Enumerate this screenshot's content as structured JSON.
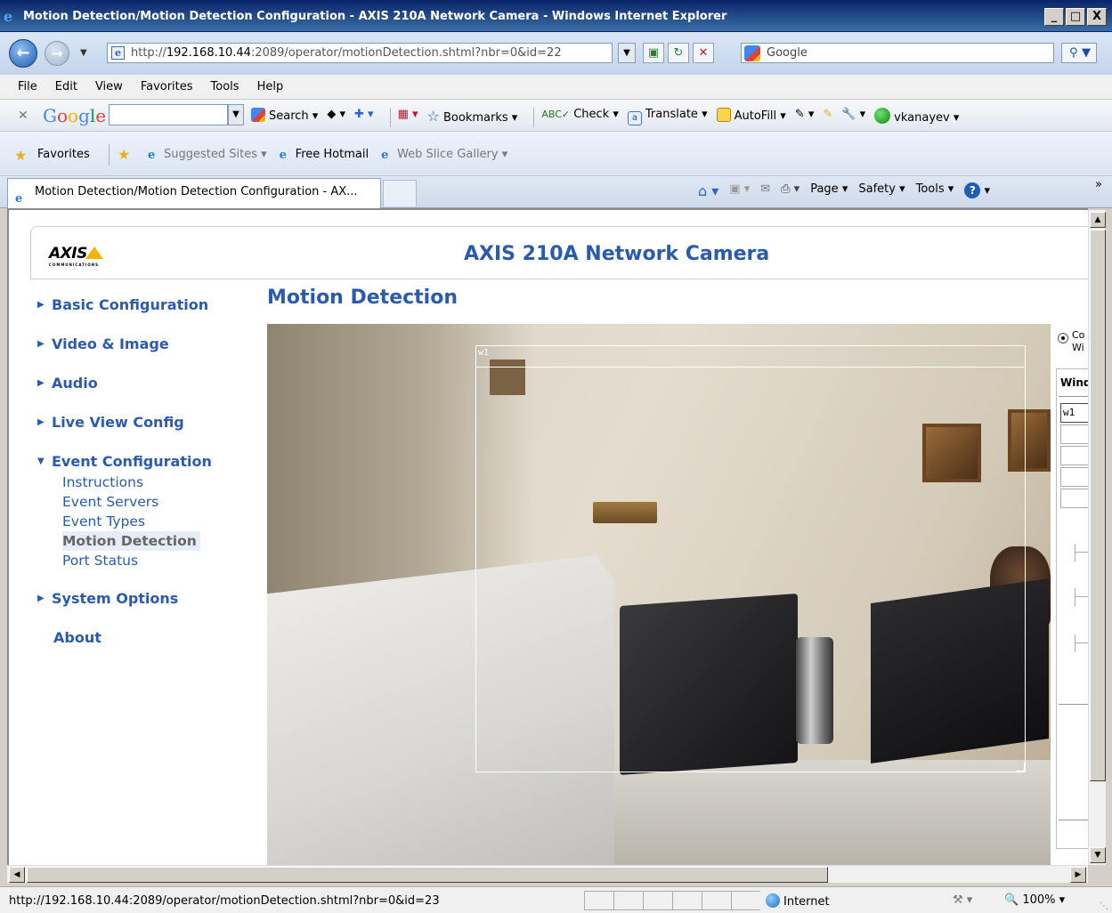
{
  "window": {
    "title": "Motion Detection/Motion Detection Configuration - AXIS 210A Network Camera - Windows Internet Explorer",
    "buttons": [
      "_",
      "□",
      "X"
    ]
  },
  "address": {
    "url_prefix": "http://",
    "url_host": "192.168.10.44",
    "url_rest": ":2089/operator/motionDetection.shtml?nbr=0&id=22",
    "search_text": "Google"
  },
  "menu": [
    "File",
    "Edit",
    "View",
    "Favorites",
    "Tools",
    "Help"
  ],
  "google_toolbar": {
    "logo": {
      "g": "G",
      "o1": "o",
      "o2": "o",
      "g2": "g",
      "l": "l",
      "e": "e"
    },
    "search_label": "Search",
    "bookmarks_label": "Bookmarks",
    "check_label": "Check",
    "translate_label": "Translate",
    "autofill_label": "AutoFill",
    "user_label": "vkanayev"
  },
  "favorites_bar": {
    "label": "Favorites",
    "items": [
      "Suggested Sites",
      "Free Hotmail",
      "Web Slice Gallery"
    ]
  },
  "tab": {
    "title": "Motion Detection/Motion Detection Configuration - AX..."
  },
  "command_bar": {
    "page_label": "Page",
    "safety_label": "Safety",
    "tools_label": "Tools"
  },
  "page": {
    "product_title": "AXIS 210A Network Camera",
    "logo_text": "AXIS",
    "logo_sub": "COMMUNICATIONS",
    "heading": "Motion Detection",
    "nav": {
      "basic": "Basic Configuration",
      "video": "Video & Image",
      "audio": "Audio",
      "liveview": "Live View Config",
      "event": "Event Configuration",
      "event_sub": [
        "Instructions",
        "Event Servers",
        "Event Types",
        "Motion Detection",
        "Port Status"
      ],
      "system": "System Options",
      "about": "About"
    },
    "motion_window_label": "w1",
    "right_panel": {
      "radio_text_1": "Co",
      "radio_text_2": "Wi",
      "table_header": "Wind",
      "first_row_value": "w1"
    }
  },
  "status": {
    "url": "http://192.168.10.44:2089/operator/motionDetection.shtml?nbr=0&id=23",
    "zone": "Internet",
    "zoom": "100%"
  }
}
